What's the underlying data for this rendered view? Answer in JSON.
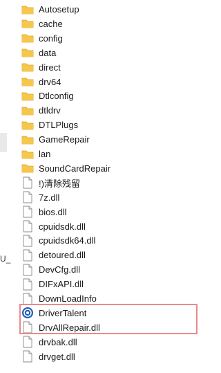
{
  "files": [
    {
      "name": "Autosetup",
      "type": "folder"
    },
    {
      "name": "cache",
      "type": "folder"
    },
    {
      "name": "config",
      "type": "folder"
    },
    {
      "name": "data",
      "type": "folder"
    },
    {
      "name": "direct",
      "type": "folder"
    },
    {
      "name": "drv64",
      "type": "folder"
    },
    {
      "name": "Dtlconfig",
      "type": "folder"
    },
    {
      "name": "dtldrv",
      "type": "folder"
    },
    {
      "name": "DTLPlugs",
      "type": "folder"
    },
    {
      "name": "GameRepair",
      "type": "folder"
    },
    {
      "name": "lan",
      "type": "folder"
    },
    {
      "name": "SoundCardRepair",
      "type": "folder"
    },
    {
      "name": "!)清除残留",
      "type": "file"
    },
    {
      "name": "7z.dll",
      "type": "file"
    },
    {
      "name": "bios.dll",
      "type": "file"
    },
    {
      "name": "cpuidsdk.dll",
      "type": "file"
    },
    {
      "name": "cpuidsdk64.dll",
      "type": "file"
    },
    {
      "name": "detoured.dll",
      "type": "file"
    },
    {
      "name": "DevCfg.dll",
      "type": "file"
    },
    {
      "name": "DIFxAPI.dll",
      "type": "file"
    },
    {
      "name": "DownLoadInfo",
      "type": "file"
    },
    {
      "name": "DriverTalent",
      "type": "app"
    },
    {
      "name": "DrvAllRepair.dll",
      "type": "file"
    },
    {
      "name": "drvbak.dll",
      "type": "file"
    },
    {
      "name": "drvget.dll",
      "type": "file"
    }
  ],
  "left_pane_fragment": "U_",
  "colors": {
    "folder": "#f5c74a",
    "folder_dark": "#dca52a",
    "app": "#1f5fb8",
    "highlight": "#e88a8a"
  }
}
